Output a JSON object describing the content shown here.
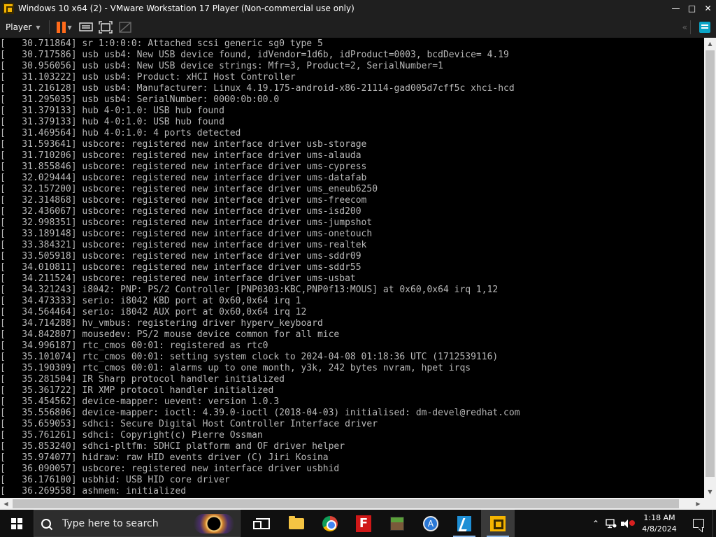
{
  "window": {
    "title": "Windows 10 x64 (2) - VMware Workstation 17 Player (Non-commercial use only)",
    "minimize_icon": "minimize-icon",
    "maximize_icon": "maximize-icon",
    "close_icon": "close-icon"
  },
  "toolbar": {
    "player_label": "Player",
    "icons": [
      "pause-icon",
      "send-ctrl-alt-del-icon",
      "fullscreen-icon",
      "unity-icon",
      "back-icon",
      "notes-icon"
    ]
  },
  "console": {
    "lines": [
      "[   30.711864] sr 1:0:0:0: Attached scsi generic sg0 type 5",
      "[   30.717586] usb usb4: New USB device found, idVendor=1d6b, idProduct=0003, bcdDevice= 4.19",
      "[   30.956056] usb usb4: New USB device strings: Mfr=3, Product=2, SerialNumber=1",
      "[   31.103222] usb usb4: Product: xHCI Host Controller",
      "[   31.216128] usb usb4: Manufacturer: Linux 4.19.175-android-x86-21114-gad005d7cff5c xhci-hcd",
      "[   31.295035] usb usb4: SerialNumber: 0000:0b:00.0",
      "[   31.379133] hub 4-0:1.0: USB hub found",
      "[   31.379133] hub 4-0:1.0: USB hub found",
      "[   31.469564] hub 4-0:1.0: 4 ports detected",
      "[   31.593641] usbcore: registered new interface driver usb-storage",
      "[   31.710206] usbcore: registered new interface driver ums-alauda",
      "[   31.855846] usbcore: registered new interface driver ums-cypress",
      "[   32.029444] usbcore: registered new interface driver ums-datafab",
      "[   32.157200] usbcore: registered new interface driver ums_eneub6250",
      "[   32.314868] usbcore: registered new interface driver ums-freecom",
      "[   32.436067] usbcore: registered new interface driver ums-isd200",
      "[   32.998351] usbcore: registered new interface driver ums-jumpshot",
      "[   33.189148] usbcore: registered new interface driver ums-onetouch",
      "[   33.384321] usbcore: registered new interface driver ums-realtek",
      "[   33.505918] usbcore: registered new interface driver ums-sddr09",
      "[   34.010811] usbcore: registered new interface driver ums-sddr55",
      "[   34.211524] usbcore: registered new interface driver ums-usbat",
      "[   34.321243] i8042: PNP: PS/2 Controller [PNP0303:KBC,PNP0f13:MOUS] at 0x60,0x64 irq 1,12",
      "[   34.473333] serio: i8042 KBD port at 0x60,0x64 irq 1",
      "[   34.564464] serio: i8042 AUX port at 0x60,0x64 irq 12",
      "[   34.714288] hv_vmbus: registering driver hyperv_keyboard",
      "[   34.842807] mousedev: PS/2 mouse device common for all mice",
      "[   34.996187] rtc_cmos 00:01: registered as rtc0",
      "[   35.101074] rtc_cmos 00:01: setting system clock to 2024-04-08 01:18:36 UTC (1712539116)",
      "[   35.190309] rtc_cmos 00:01: alarms up to one month, y3k, 242 bytes nvram, hpet irqs",
      "[   35.281504] IR Sharp protocol handler initialized",
      "[   35.361722] IR XMP protocol handler initialized",
      "[   35.454562] device-mapper: uevent: version 1.0.3",
      "[   35.556806] device-mapper: ioctl: 4.39.0-ioctl (2018-04-03) initialised: dm-devel@redhat.com",
      "[   35.659053] sdhci: Secure Digital Host Controller Interface driver",
      "[   35.761261] sdhci: Copyright(c) Pierre Ossman",
      "[   35.853240] sdhci-pltfm: SDHCI platform and OF driver helper",
      "[   35.974077] hidraw: raw HID events driver (C) Jiri Kosina",
      "[   36.090057] usbcore: registered new interface driver usbhid",
      "[   36.176100] usbhid: USB HID core driver",
      "[   36.269558] ashmem: initialized"
    ]
  },
  "taskbar": {
    "search_placeholder": "Type here to search",
    "apps": [
      "task-view-icon",
      "file-explorer-icon",
      "chrome-icon",
      "f-app-icon",
      "minecraft-icon",
      "accessibility-app-icon",
      "visual-studio-icon",
      "vmware-icon"
    ],
    "time": "1:18 AM",
    "date": "4/8/2024"
  },
  "colors": {
    "console_text": "#b8b8b8",
    "console_bg": "#000000",
    "pause_accent": "#ff6a1a",
    "notes_accent": "#0aa4c6"
  }
}
